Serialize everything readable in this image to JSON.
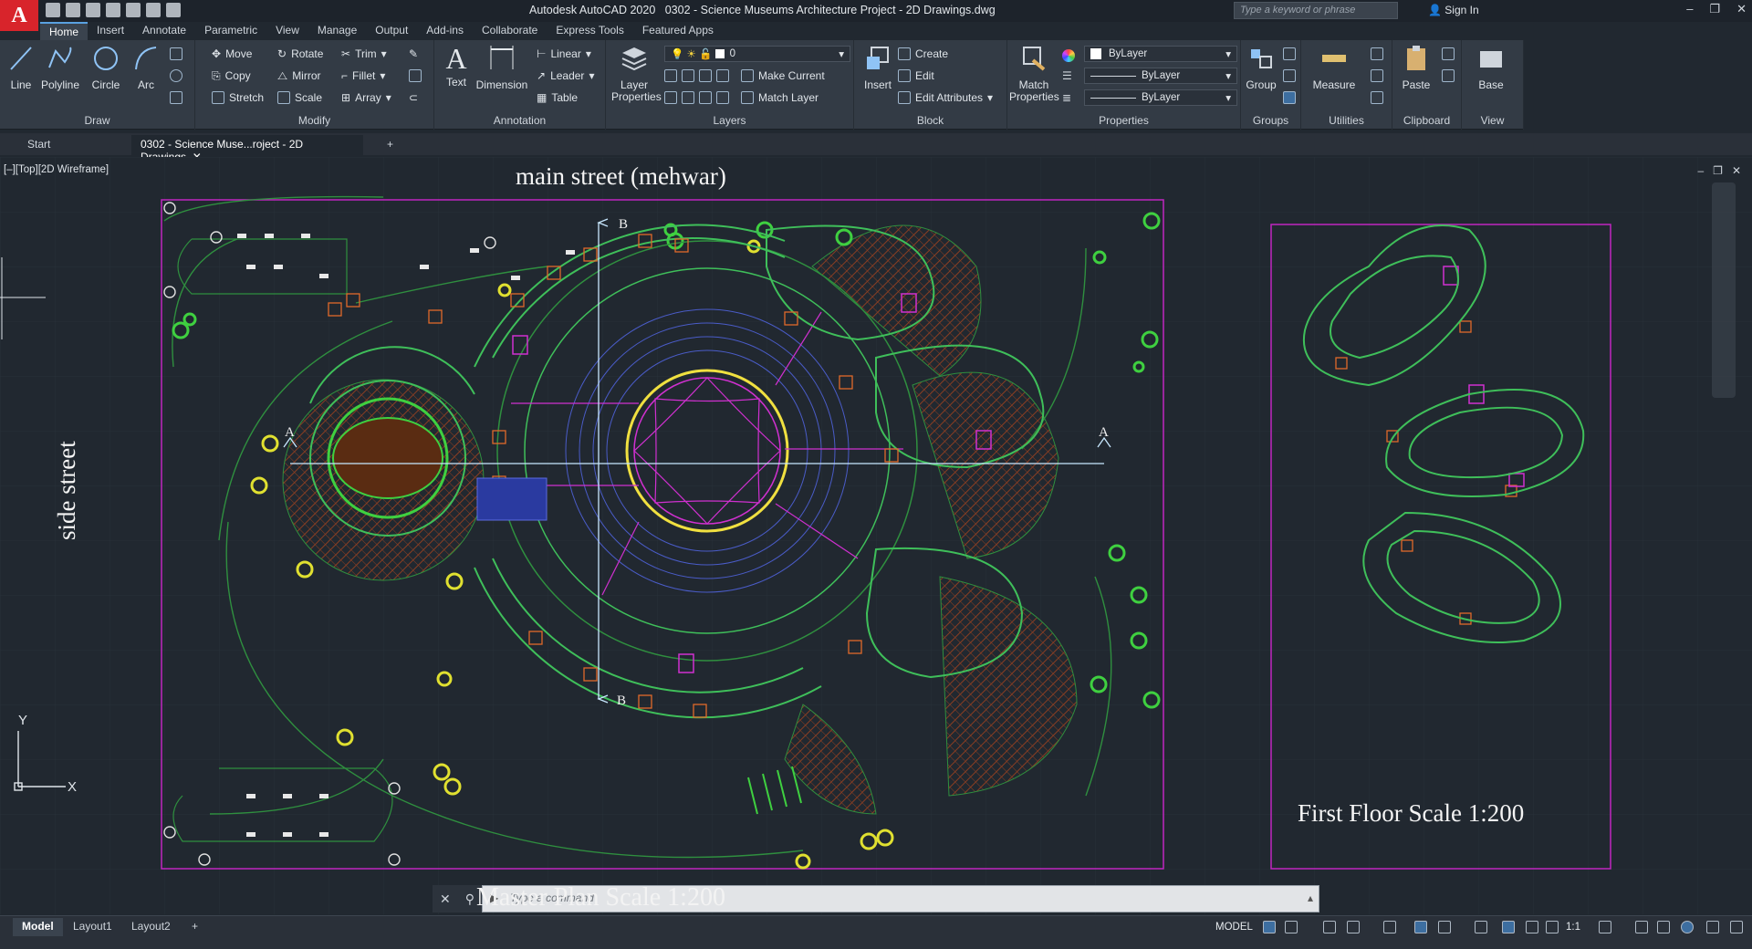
{
  "titlebar": {
    "app_title": "Autodesk AutoCAD 2020",
    "doc_title": "0302 - Science Museums Architecture Project - 2D Drawings.dwg",
    "search_placeholder": "Type a keyword or phrase",
    "signin": "Sign In",
    "logo": "A"
  },
  "ribbon_tabs": [
    "Home",
    "Insert",
    "Annotate",
    "Parametric",
    "View",
    "Manage",
    "Output",
    "Add-ins",
    "Collaborate",
    "Express Tools",
    "Featured Apps"
  ],
  "draw": {
    "label": "Draw",
    "line": "Line",
    "polyline": "Polyline",
    "circle": "Circle",
    "arc": "Arc"
  },
  "modify": {
    "label": "Modify",
    "move": "Move",
    "rotate": "Rotate",
    "trim": "Trim",
    "copy": "Copy",
    "mirror": "Mirror",
    "fillet": "Fillet",
    "stretch": "Stretch",
    "scale": "Scale",
    "array": "Array"
  },
  "annotation": {
    "label": "Annotation",
    "text": "Text",
    "dimension": "Dimension",
    "linear": "Linear",
    "leader": "Leader",
    "table": "Table"
  },
  "layers": {
    "label": "Layers",
    "layer_properties_1": "Layer",
    "layer_properties_2": "Properties",
    "layer_value": "0",
    "make_current": "Make Current",
    "match_layer": "Match Layer"
  },
  "block": {
    "label": "Block",
    "insert": "Insert",
    "create": "Create",
    "edit": "Edit",
    "edit_attributes": "Edit Attributes"
  },
  "properties": {
    "label": "Properties",
    "match_1": "Match",
    "match_2": "Properties",
    "color": "ByLayer",
    "linetype": "ByLayer",
    "lineweight": "ByLayer"
  },
  "groups": {
    "label": "Groups",
    "group": "Group"
  },
  "utilities": {
    "label": "Utilities",
    "measure": "Measure"
  },
  "clipboard": {
    "label": "Clipboard",
    "paste": "Paste"
  },
  "view_panel": {
    "label": "View",
    "base": "Base"
  },
  "doc_tabs": {
    "start": "Start",
    "active": "0302 - Science Muse...roject - 2D Drawings",
    "close": "✕",
    "add": "+"
  },
  "viewport": {
    "label": "[–][Top][2D Wireframe]"
  },
  "drawing": {
    "main_street": "main street (mehwar)",
    "side_street": "side street",
    "first_floor": "First Floor Scale 1:200",
    "master_plan": "Master Plan Scale 1:200",
    "section_a": "A",
    "section_b": "B",
    "ucs_x": "X",
    "ucs_y": "Y"
  },
  "commandline": {
    "placeholder": "Type a command"
  },
  "layout_tabs": [
    "Model",
    "Layout1",
    "Layout2"
  ],
  "status": {
    "model": "MODEL",
    "scale": "1:1"
  },
  "colors": {
    "plot_border": "#c026c0",
    "walls": "#3fbf5a",
    "furniture": "#e06a2a",
    "axis": "#c8e8ff",
    "hatch": "#8a3e22",
    "ring_yellow": "#f0e040"
  }
}
